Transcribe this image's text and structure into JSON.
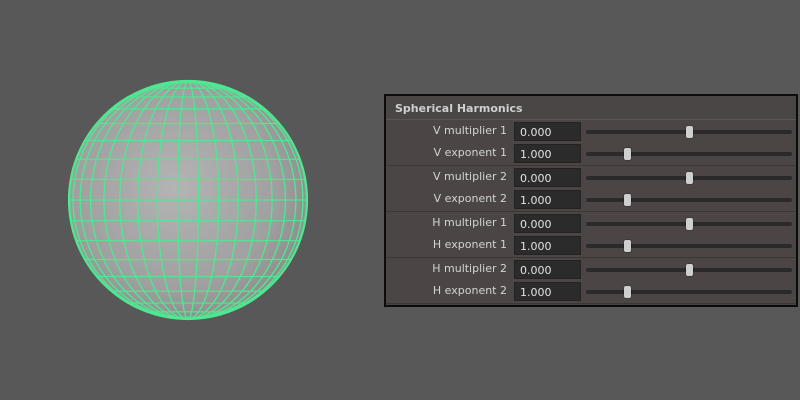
{
  "viewport": {
    "object_icon": "sphere-wireframe-icon",
    "wire_color": "#4ee891",
    "surface_color": "#a8a8a8"
  },
  "panel": {
    "title": "Spherical Harmonics",
    "groups": [
      {
        "rows": [
          {
            "label": "V multiplier 1",
            "value": "0.000",
            "slider_fraction": 0.5
          },
          {
            "label": "V exponent 1",
            "value": "1.000",
            "slider_fraction": 0.2
          }
        ]
      },
      {
        "rows": [
          {
            "label": "V multiplier 2",
            "value": "0.000",
            "slider_fraction": 0.5
          },
          {
            "label": "V exponent 2",
            "value": "1.000",
            "slider_fraction": 0.2
          }
        ]
      },
      {
        "rows": [
          {
            "label": "H multiplier 1",
            "value": "0.000",
            "slider_fraction": 0.5
          },
          {
            "label": "H exponent 1",
            "value": "1.000",
            "slider_fraction": 0.2
          }
        ]
      },
      {
        "rows": [
          {
            "label": "H multiplier 2",
            "value": "0.000",
            "slider_fraction": 0.5
          },
          {
            "label": "H exponent 2",
            "value": "1.000",
            "slider_fraction": 0.2
          }
        ]
      }
    ]
  },
  "colors": {
    "background": "#585858",
    "panel_background": "#474242",
    "field_background": "#2b2b2b",
    "wireframe": "#4ee891"
  }
}
